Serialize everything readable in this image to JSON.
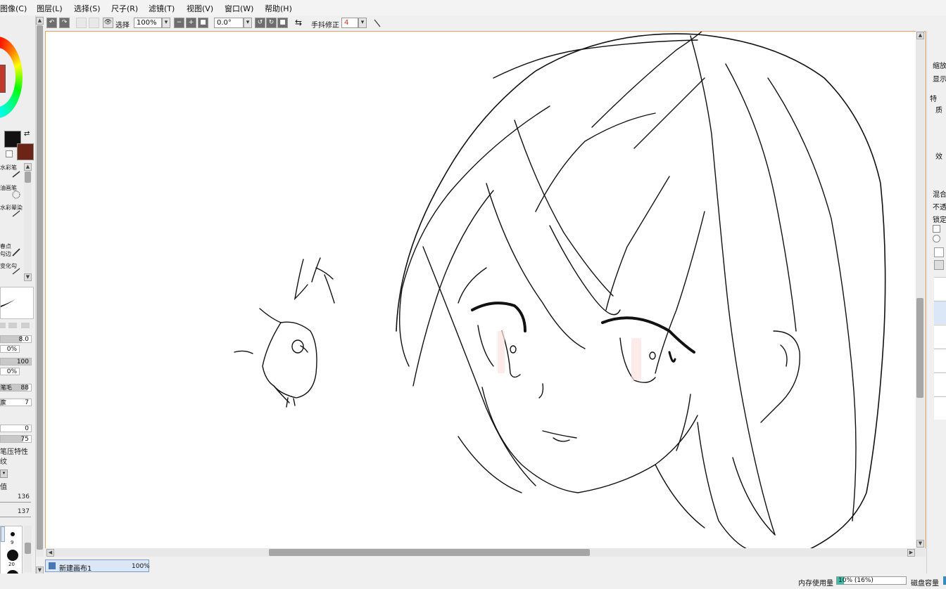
{
  "menu": [
    "图像(C)",
    "图层(L)",
    "选择(S)",
    "尺子(R)",
    "滤镜(T)",
    "视图(V)",
    "窗口(W)",
    "帮助(H)"
  ],
  "toolbar": {
    "select_label": "选择",
    "zoom_value": "100%",
    "angle_value": "0.0°",
    "stabilizer_label": "手抖修正",
    "stabilizer_value": "4"
  },
  "left_panel": {
    "tools": [
      "水彩笔",
      "油画笔",
      "水彩晕染",
      "春点",
      "勾边",
      "变化勾"
    ],
    "params": [
      {
        "value": "8.0",
        "fill": 0.7
      },
      {
        "value": "0%",
        "fill": 0.0
      },
      {
        "value": "100",
        "fill": 1.0
      },
      {
        "value": "0%",
        "fill": 0.0
      },
      {
        "value": "88",
        "fill": 0.88,
        "label": "笔毛"
      },
      {
        "value": "7",
        "fill": 0.1,
        "label": "度"
      }
    ],
    "values2": [
      "0",
      "75"
    ],
    "pressure_label": "笔压特性",
    "texture_label": "纹",
    "blend_label": "值",
    "values3": [
      "136",
      "137"
    ],
    "brush_sizes": [
      "9",
      "20"
    ]
  },
  "canvas": {
    "tab_name": "新建画布1",
    "tab_zoom": "100%"
  },
  "right_panel": {
    "labels": [
      "缩放",
      "显示",
      "特",
      "质",
      "效",
      "混合",
      "不透",
      "锁定"
    ]
  },
  "status": {
    "memory_label": "内存使用量",
    "memory_value": "10% (16%)",
    "memory_fraction": 0.1,
    "disk_label": "磁盘容量"
  },
  "colors": {
    "primary": "#111111",
    "secondary": "#6b2415",
    "canvas_border": "#e5a060",
    "selection_tab": "#dbe6f6"
  }
}
